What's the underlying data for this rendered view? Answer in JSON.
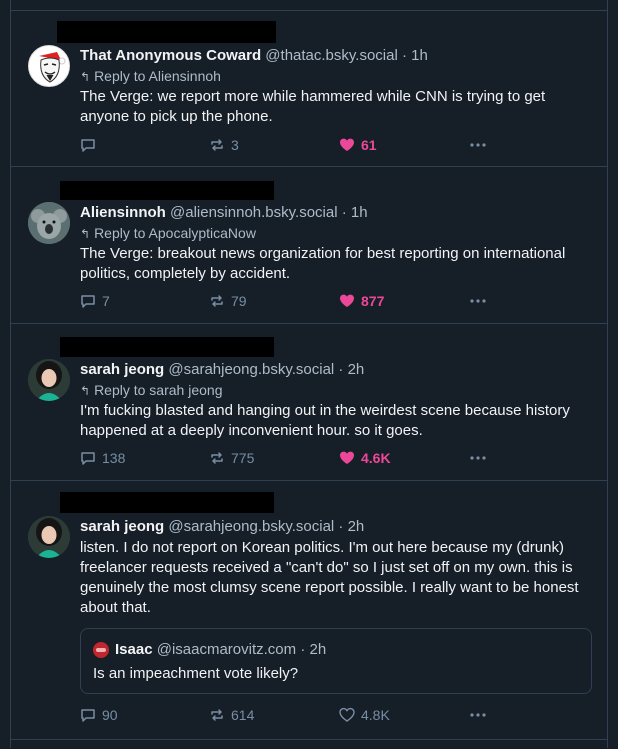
{
  "posts": [
    {
      "name": "That Anonymous Coward",
      "handle": "@thatac.bsky.social",
      "time": "· 1h",
      "reply_to": "Reply to Aliensinnoh",
      "text": "The Verge: we report more while hammered while CNN is trying to get anyone to pick up the phone.",
      "replies": "",
      "reposts": "3",
      "likes": "61",
      "liked": true
    },
    {
      "name": "Aliensinnoh",
      "handle": "@aliensinnoh.bsky.social",
      "time": "· 1h",
      "reply_to": "Reply to ApocalypticaNow",
      "text": "The Verge: breakout news organization for best reporting on international politics, completely by accident.",
      "replies": "7",
      "reposts": "79",
      "likes": "877",
      "liked": true
    },
    {
      "name": "sarah jeong",
      "handle": "@sarahjeong.bsky.social",
      "time": "· 2h",
      "reply_to": "Reply to sarah jeong",
      "text": "I'm fucking blasted and hanging out in the weirdest scene because history happened at a deeply inconvenient hour. so it goes.",
      "replies": "138",
      "reposts": "775",
      "likes": "4.6K",
      "liked": true
    },
    {
      "name": "sarah jeong",
      "handle": "@sarahjeong.bsky.social",
      "time": "· 2h",
      "text": "listen. I do not report on Korean politics. I'm out here because my (drunk) freelancer requests received a \"can't do\" so I just set off on my own. this is genuinely the most clumsy scene report possible. I really want to be honest about that.",
      "quote": {
        "name": "Isaac",
        "handle": "@isaacmarovitz.com",
        "time": "· 2h",
        "text": "Is an impeachment vote likely?"
      },
      "replies": "90",
      "reposts": "614",
      "likes": "4.8K",
      "liked": false
    }
  ],
  "icons": {
    "reply": "speech-bubble-icon",
    "repost": "repost-arrows-icon",
    "like": "heart-icon",
    "more": "ellipsis-icon",
    "reply_arrow": "reply-arrow-icon"
  },
  "colors": {
    "background": "#161e27",
    "border": "#2e4052",
    "secondary_text": "#aebbc9",
    "action_text": "#788ea5",
    "like": "#ec4899"
  }
}
